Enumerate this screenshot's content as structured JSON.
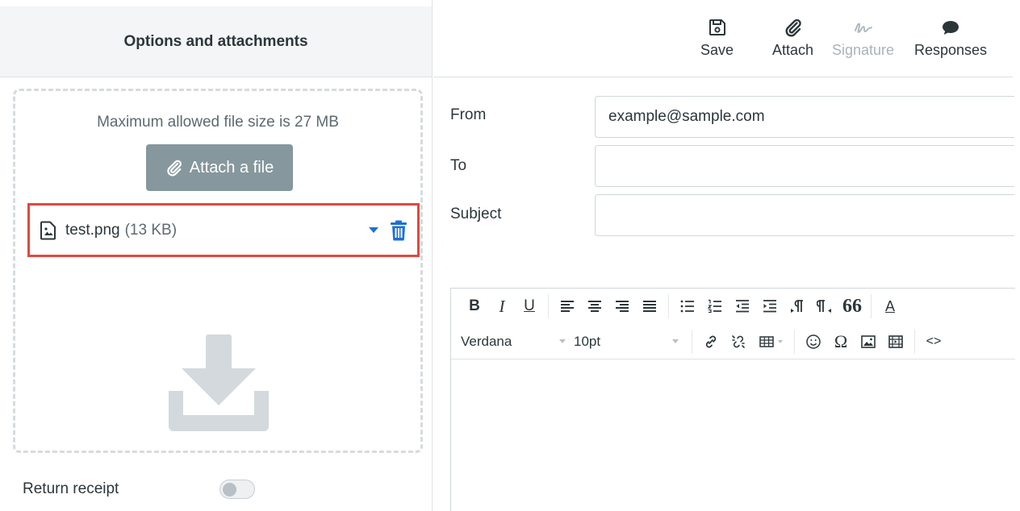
{
  "left_panel": {
    "title": "Options and attachments",
    "dropzone": {
      "max_size_text": "Maximum allowed file size is 27 MB",
      "attach_button_label": "Attach a file"
    },
    "attachment": {
      "name": "test.png",
      "size": "(13 KB)"
    },
    "return_receipt": {
      "label": "Return receipt",
      "enabled": false
    }
  },
  "toolbar": {
    "save_label": "Save",
    "attach_label": "Attach",
    "signature_label": "Signature",
    "responses_label": "Responses"
  },
  "compose": {
    "from_label": "From",
    "from_value": "example@sample.com",
    "to_label": "To",
    "to_value": "",
    "subject_label": "Subject",
    "subject_value": ""
  },
  "editor": {
    "bold": "B",
    "italic": "I",
    "underline": "U",
    "blockquote": "66",
    "text_color": "A",
    "font_family": "Verdana",
    "font_size": "10pt",
    "special_char": "Ω",
    "source_code": "<>"
  },
  "colors": {
    "highlight_border": "#e0483d",
    "accent_blue": "#1f6fd6",
    "button_gray": "#86979d"
  }
}
